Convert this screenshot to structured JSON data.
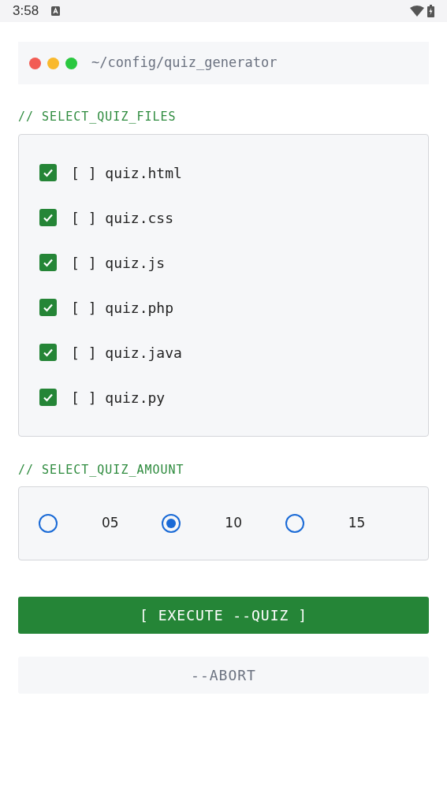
{
  "status_bar": {
    "time": "3:58"
  },
  "header": {
    "path": "~/config/quiz_generator"
  },
  "files_section": {
    "label": "// SELECT_QUIZ_FILES",
    "files": [
      {
        "label": "[ ] quiz.html",
        "checked": true
      },
      {
        "label": "[ ] quiz.css",
        "checked": true
      },
      {
        "label": "[ ] quiz.js",
        "checked": true
      },
      {
        "label": "[ ] quiz.php",
        "checked": true
      },
      {
        "label": "[ ] quiz.java",
        "checked": true
      },
      {
        "label": "[ ] quiz.py",
        "checked": true
      }
    ]
  },
  "amount_section": {
    "label": "// SELECT_QUIZ_AMOUNT",
    "options": [
      {
        "label": "05",
        "selected": false
      },
      {
        "label": "10",
        "selected": true
      },
      {
        "label": "15",
        "selected": false
      }
    ]
  },
  "buttons": {
    "execute": "[ EXECUTE --QUIZ ]",
    "abort": "--ABORT"
  }
}
